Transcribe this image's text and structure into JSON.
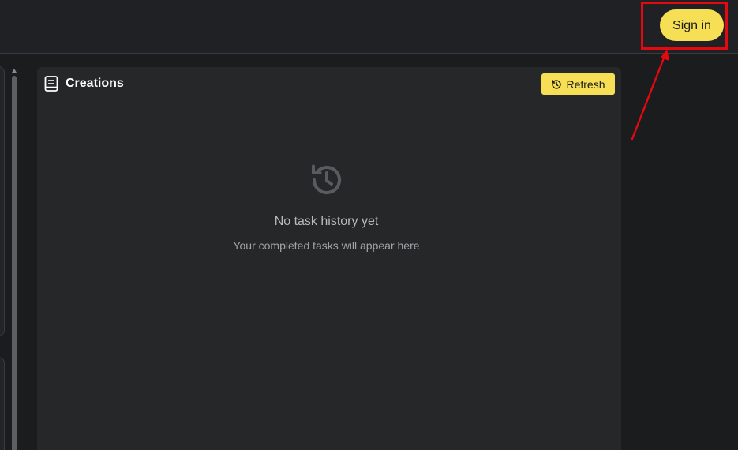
{
  "header": {
    "signin_label": "Sign in"
  },
  "creations": {
    "title": "Creations",
    "refresh_label": "Refresh",
    "empty_title": "No task history yet",
    "empty_subtitle": "Your completed tasks will appear here"
  },
  "icons": {
    "panel": "book-icon",
    "refresh": "history-refresh-icon",
    "empty": "history-icon"
  },
  "colors": {
    "accent": "#f6df55",
    "annotation": "#e5090f",
    "background": "#1b1c1e",
    "panel": "#262728"
  }
}
